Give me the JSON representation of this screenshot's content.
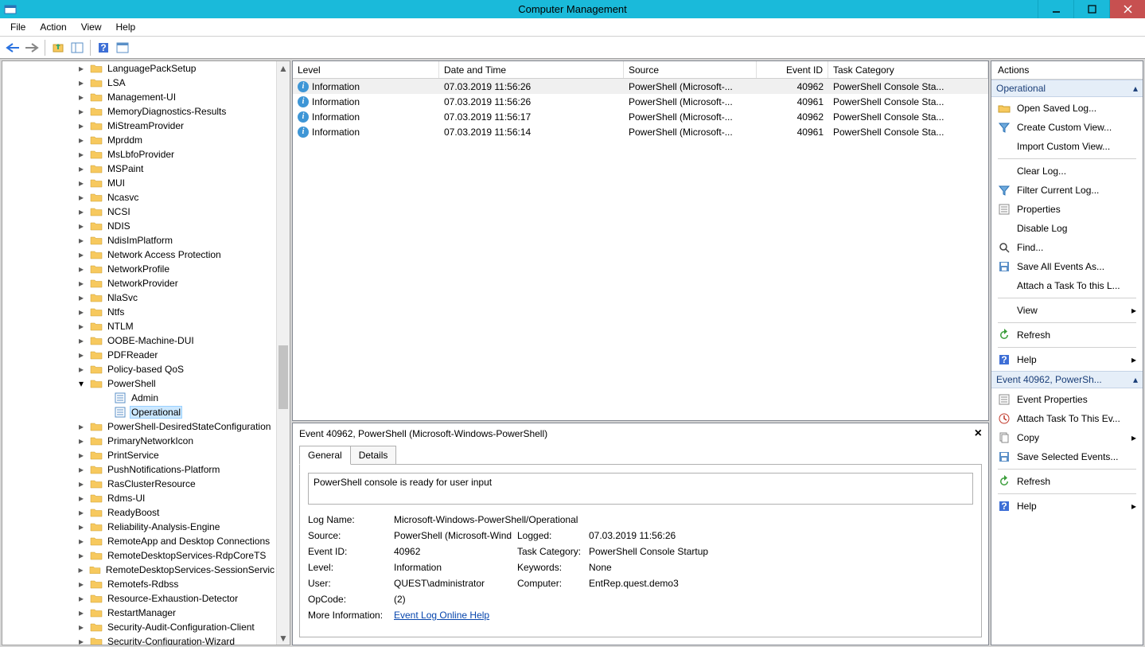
{
  "window": {
    "title": "Computer Management"
  },
  "menu": {
    "file": "File",
    "action": "Action",
    "view": "View",
    "help": "Help"
  },
  "tree": {
    "items": [
      {
        "label": "LanguagePackSetup",
        "depth": 0
      },
      {
        "label": "LSA",
        "depth": 0
      },
      {
        "label": "Management-UI",
        "depth": 0
      },
      {
        "label": "MemoryDiagnostics-Results",
        "depth": 0
      },
      {
        "label": "MiStreamProvider",
        "depth": 0
      },
      {
        "label": "Mprddm",
        "depth": 0
      },
      {
        "label": "MsLbfoProvider",
        "depth": 0
      },
      {
        "label": "MSPaint",
        "depth": 0
      },
      {
        "label": "MUI",
        "depth": 0
      },
      {
        "label": "Ncasvc",
        "depth": 0
      },
      {
        "label": "NCSI",
        "depth": 0
      },
      {
        "label": "NDIS",
        "depth": 0
      },
      {
        "label": "NdisImPlatform",
        "depth": 0
      },
      {
        "label": "Network Access Protection",
        "depth": 0
      },
      {
        "label": "NetworkProfile",
        "depth": 0
      },
      {
        "label": "NetworkProvider",
        "depth": 0
      },
      {
        "label": "NlaSvc",
        "depth": 0
      },
      {
        "label": "Ntfs",
        "depth": 0
      },
      {
        "label": "NTLM",
        "depth": 0
      },
      {
        "label": "OOBE-Machine-DUI",
        "depth": 0
      },
      {
        "label": "PDFReader",
        "depth": 0
      },
      {
        "label": "Policy-based QoS",
        "depth": 0
      },
      {
        "label": "PowerShell",
        "depth": 0,
        "expanded": true
      },
      {
        "label": "Admin",
        "depth": 1,
        "leaf": true
      },
      {
        "label": "Operational",
        "depth": 1,
        "leaf": true,
        "selected": true
      },
      {
        "label": "PowerShell-DesiredStateConfiguration",
        "depth": 0
      },
      {
        "label": "PrimaryNetworkIcon",
        "depth": 0
      },
      {
        "label": "PrintService",
        "depth": 0
      },
      {
        "label": "PushNotifications-Platform",
        "depth": 0
      },
      {
        "label": "RasClusterResource",
        "depth": 0
      },
      {
        "label": "Rdms-UI",
        "depth": 0
      },
      {
        "label": "ReadyBoost",
        "depth": 0
      },
      {
        "label": "Reliability-Analysis-Engine",
        "depth": 0
      },
      {
        "label": "RemoteApp and Desktop Connections",
        "depth": 0
      },
      {
        "label": "RemoteDesktopServices-RdpCoreTS",
        "depth": 0
      },
      {
        "label": "RemoteDesktopServices-SessionServic",
        "depth": 0
      },
      {
        "label": "Remotefs-Rdbss",
        "depth": 0
      },
      {
        "label": "Resource-Exhaustion-Detector",
        "depth": 0
      },
      {
        "label": "RestartManager",
        "depth": 0
      },
      {
        "label": "Security-Audit-Configuration-Client",
        "depth": 0
      },
      {
        "label": "Security-Configuration-Wizard",
        "depth": 0
      }
    ]
  },
  "grid": {
    "headers": {
      "level": "Level",
      "date": "Date and Time",
      "source": "Source",
      "id": "Event ID",
      "task": "Task Category"
    },
    "rows": [
      {
        "level": "Information",
        "date": "07.03.2019 11:56:26",
        "source": "PowerShell (Microsoft-...",
        "id": "40962",
        "task": "PowerShell Console Sta...",
        "sel": true
      },
      {
        "level": "Information",
        "date": "07.03.2019 11:56:26",
        "source": "PowerShell (Microsoft-...",
        "id": "40961",
        "task": "PowerShell Console Sta..."
      },
      {
        "level": "Information",
        "date": "07.03.2019 11:56:17",
        "source": "PowerShell (Microsoft-...",
        "id": "40962",
        "task": "PowerShell Console Sta..."
      },
      {
        "level": "Information",
        "date": "07.03.2019 11:56:14",
        "source": "PowerShell (Microsoft-...",
        "id": "40961",
        "task": "PowerShell Console Sta..."
      }
    ]
  },
  "details": {
    "title": "Event 40962, PowerShell (Microsoft-Windows-PowerShell)",
    "tabs": {
      "general": "General",
      "details": "Details"
    },
    "message": "PowerShell console is ready for user input",
    "props": {
      "log_name_label": "Log Name:",
      "log_name": "Microsoft-Windows-PowerShell/Operational",
      "source_label": "Source:",
      "source": "PowerShell (Microsoft-Wind",
      "logged_label": "Logged:",
      "logged": "07.03.2019 11:56:26",
      "event_id_label": "Event ID:",
      "event_id": "40962",
      "task_label": "Task Category:",
      "task": "PowerShell Console Startup",
      "level_label": "Level:",
      "level": "Information",
      "keywords_label": "Keywords:",
      "keywords": "None",
      "user_label": "User:",
      "user": "QUEST\\administrator",
      "computer_label": "Computer:",
      "computer": "EntRep.quest.demo3",
      "opcode_label": "OpCode:",
      "opcode": "(2)",
      "more_label": "More Information:",
      "more_link": "Event Log Online Help"
    }
  },
  "actions": {
    "title": "Actions",
    "hdr1": "Operational",
    "hdr2": "Event 40962, PowerSh...",
    "group1": [
      {
        "label": "Open Saved Log...",
        "icon": "folder"
      },
      {
        "label": "Create Custom View...",
        "icon": "filter"
      },
      {
        "label": "Import Custom View...",
        "icon": ""
      },
      {
        "label": "Clear Log...",
        "icon": "",
        "divider_before": true
      },
      {
        "label": "Filter Current Log...",
        "icon": "filter"
      },
      {
        "label": "Properties",
        "icon": "props"
      },
      {
        "label": "Disable Log",
        "icon": ""
      },
      {
        "label": "Find...",
        "icon": "find"
      },
      {
        "label": "Save All Events As...",
        "icon": "save"
      },
      {
        "label": "Attach a Task To this L...",
        "icon": ""
      },
      {
        "label": "View",
        "icon": "",
        "arrow": true,
        "divider_before": true
      },
      {
        "label": "Refresh",
        "icon": "refresh",
        "divider_before": true
      },
      {
        "label": "Help",
        "icon": "help",
        "arrow": true,
        "divider_before": true
      }
    ],
    "group2": [
      {
        "label": "Event Properties",
        "icon": "props"
      },
      {
        "label": "Attach Task To This Ev...",
        "icon": "task"
      },
      {
        "label": "Copy",
        "icon": "copy",
        "arrow": true
      },
      {
        "label": "Save Selected Events...",
        "icon": "save"
      },
      {
        "label": "Refresh",
        "icon": "refresh",
        "divider_before": true
      },
      {
        "label": "Help",
        "icon": "help",
        "arrow": true,
        "divider_before": true
      }
    ]
  }
}
